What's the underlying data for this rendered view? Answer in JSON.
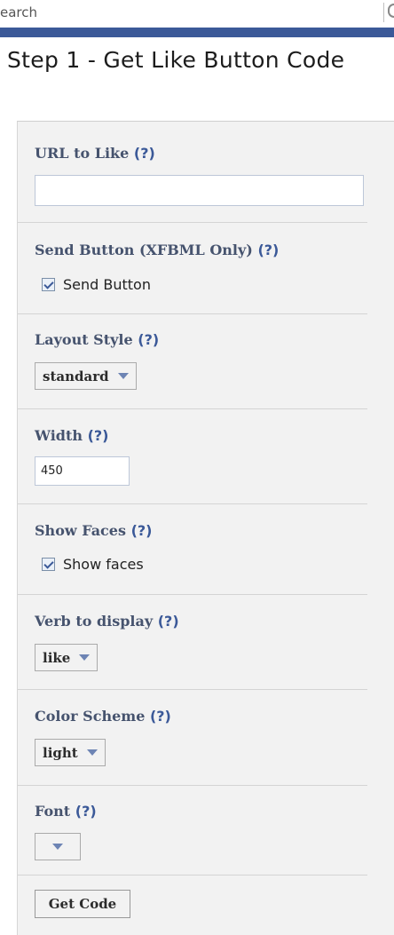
{
  "header": {
    "search_text": "earch",
    "title": "Step 1 - Get Like Button Code"
  },
  "help_marker": "(?)",
  "form": {
    "url": {
      "label": "URL to Like",
      "value": ""
    },
    "send_button": {
      "label": "Send Button (XFBML Only)",
      "checkbox_label": "Send Button",
      "checked": true
    },
    "layout_style": {
      "label": "Layout Style",
      "value": "standard"
    },
    "width": {
      "label": "Width",
      "value": "450"
    },
    "show_faces": {
      "label": "Show Faces",
      "checkbox_label": "Show faces",
      "checked": true
    },
    "verb": {
      "label": "Verb to display",
      "value": "like"
    },
    "color_scheme": {
      "label": "Color Scheme",
      "value": "light"
    },
    "font": {
      "label": "Font",
      "value": ""
    },
    "submit_label": "Get Code"
  },
  "colors": {
    "brand_blue": "#3b5998",
    "panel_bg": "#f2f2f2",
    "label_color": "#46536e"
  }
}
